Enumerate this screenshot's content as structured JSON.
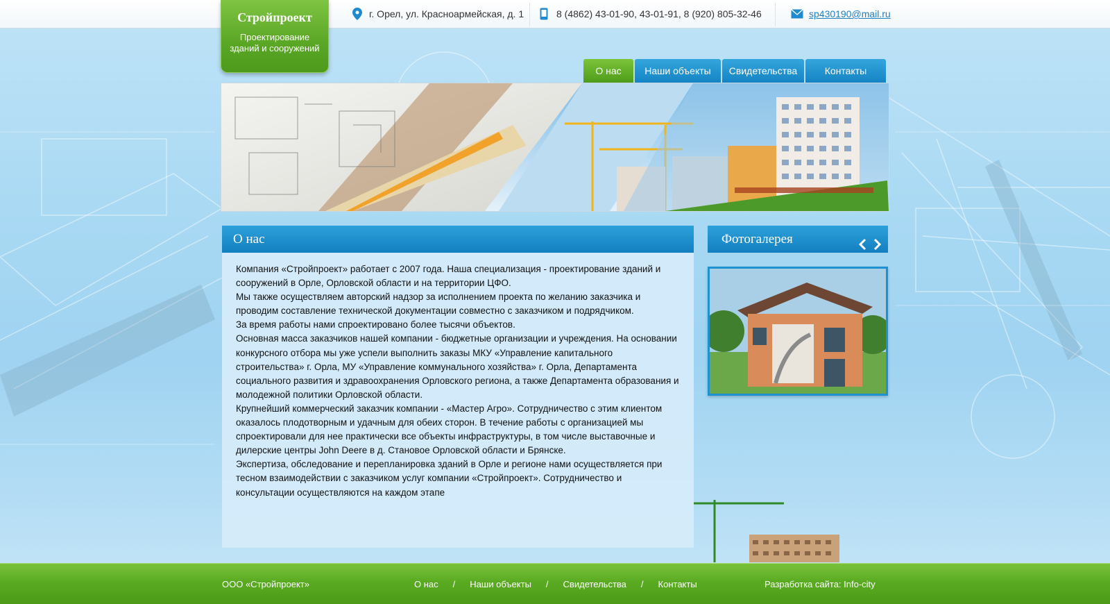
{
  "header": {
    "address": "г. Орел, ул. Красноармейская, д. 1",
    "phones": "8 (4862) 43-01-90, 43-01-91, 8 (920) 805-32-46",
    "email": "sp430190@mail.ru"
  },
  "logo": {
    "title": "Стройпроект",
    "subtitle_line1": "Проектирование",
    "subtitle_line2": "зданий и сооружений"
  },
  "nav": [
    "О нас",
    "Наши объекты",
    "Свидетельства",
    "Контакты"
  ],
  "nav_active": "О нас",
  "content": {
    "title": "О нас",
    "paragraphs": [
      "Компания «Стройпроект»  работает с 2007 года.  Наша специализация - проектирование зданий и сооружений в Орле, Орловской области и на территории ЦФО.",
      "Мы также осуществляем  авторский надзор за исполнением проекта по желанию заказчика и проводим составление технической документации совместно с заказчиком и подрядчиком.",
      "За время работы нами спроектировано более тысячи объектов.",
      "Основная масса заказчиков  нашей компании  - бюджетные организации и учреждения. На основании конкурсного отбора мы уже успели выполнить заказы МКУ  «Управление капитального строительства»  г. Орла, МУ «Управление коммунального хозяйства»  г. Орла,   Департамента социального развития  и здравоохранения Орловского региона, а также Департамента образования и молодежной политики Орловской области.",
      "Крупнейший коммерческий заказчик компании  - «Мастер Агро». Сотрудничество с этим клиентом оказалось плодотворным  и удачным для обеих сторон. В течение работы с организацией мы спроектировали для нее практически все  объекты инфраструктуры,  в том числе  выставочные и дилерские центры John Deere в д. Становое Орловской области и Брянске.",
      "Экспертиза, обследование и перепланировка зданий в Орле и регионе нами осуществляется при тесном взаимодействии с заказчиком услуг компании «Стройпроект».  Сотрудничество и консультации осуществляются  на каждом этапе"
    ]
  },
  "gallery": {
    "title": "Фотогалерея"
  },
  "footer": {
    "company": "ООО «Стройпроект»",
    "links": [
      "О нас",
      "Наши объекты",
      "Свидетельства",
      "Контакты"
    ],
    "separator": "/",
    "developer": "Разработка сайта: Info-city"
  },
  "colors": {
    "green": "#5aa625",
    "blue": "#1383c4",
    "link": "#1e7fc4"
  }
}
